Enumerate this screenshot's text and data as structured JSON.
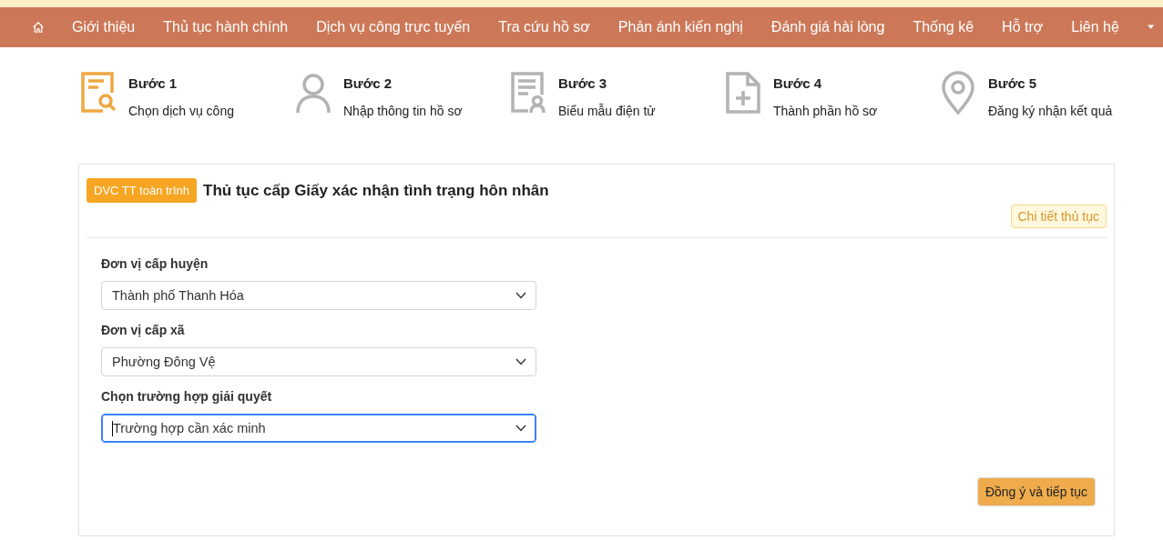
{
  "nav": {
    "items": [
      {
        "label": "Giới thiệu"
      },
      {
        "label": "Thủ tục hành chính"
      },
      {
        "label": "Dịch vụ công trực tuyến"
      },
      {
        "label": "Tra cứu hồ sơ"
      },
      {
        "label": "Phản ánh kiến nghị"
      },
      {
        "label": "Đánh giá hài lòng"
      },
      {
        "label": "Thống kê"
      },
      {
        "label": "Hỗ trợ"
      },
      {
        "label": "Liên hệ"
      }
    ]
  },
  "steps": [
    {
      "kind": "search-doc",
      "title": "Bước 1",
      "label": "Chọn dịch vụ công",
      "selected": true
    },
    {
      "kind": "person",
      "title": "Bước 2",
      "label": "Nhập thông tin hồ sơ",
      "selected": false
    },
    {
      "kind": "person-doc",
      "title": "Bước 3",
      "label": "Biểu mẫu điện tử",
      "selected": false
    },
    {
      "kind": "file-plus",
      "title": "Bước 4",
      "label": "Thành phần hồ sơ",
      "selected": false
    },
    {
      "kind": "pin",
      "title": "Bước 5",
      "label": "Đăng ký nhận kết quả",
      "selected": false
    }
  ],
  "card": {
    "badge": "DVC TT toàn trình",
    "title": "Thủ tục cấp Giấy xác nhận tình trạng hôn nhân",
    "detail_button": "Chi tiết thủ tục",
    "fields": [
      {
        "label": "Đơn vị cấp huyện",
        "value": "Thành phố Thanh Hóa",
        "focused": false
      },
      {
        "label": "Đơn vị cấp xã",
        "value": "Phường Đông Vệ",
        "focused": false
      },
      {
        "label": "Chọn trường hợp giải quyết",
        "value": "Trường hợp cần xác minh",
        "focused": true
      }
    ],
    "submit_button": "Đồng ý và tiếp tục"
  }
}
